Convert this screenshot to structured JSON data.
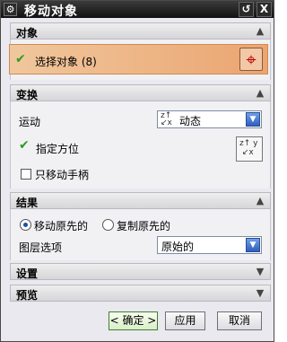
{
  "window": {
    "title": "移动对象",
    "gear_glyph": "⚙",
    "reset_glyph": "↺",
    "close_glyph": "X"
  },
  "sections": {
    "object": {
      "title": "对象",
      "select_label": "选择对象 (8)"
    },
    "transform": {
      "title": "变换",
      "motion_label": "运动",
      "motion_value": "动态",
      "orient_label": "指定方位",
      "move_handle_only_label": "只移动手柄",
      "move_handle_only_checked": false
    },
    "result": {
      "title": "结果",
      "move_original_label": "移动原先的",
      "copy_original_label": "复制原先的",
      "selected": "move_original",
      "layer_option_label": "图层选项",
      "layer_option_value": "原始的"
    },
    "settings": {
      "title": "设置"
    },
    "preview": {
      "title": "预览"
    }
  },
  "buttons": {
    "ok": "< 确定 >",
    "apply": "应用",
    "cancel": "取消"
  },
  "colors": {
    "selection_highlight": "#eba571",
    "check_green": "#2e9a21",
    "dropdown_arrow": "#2f5fbf"
  }
}
